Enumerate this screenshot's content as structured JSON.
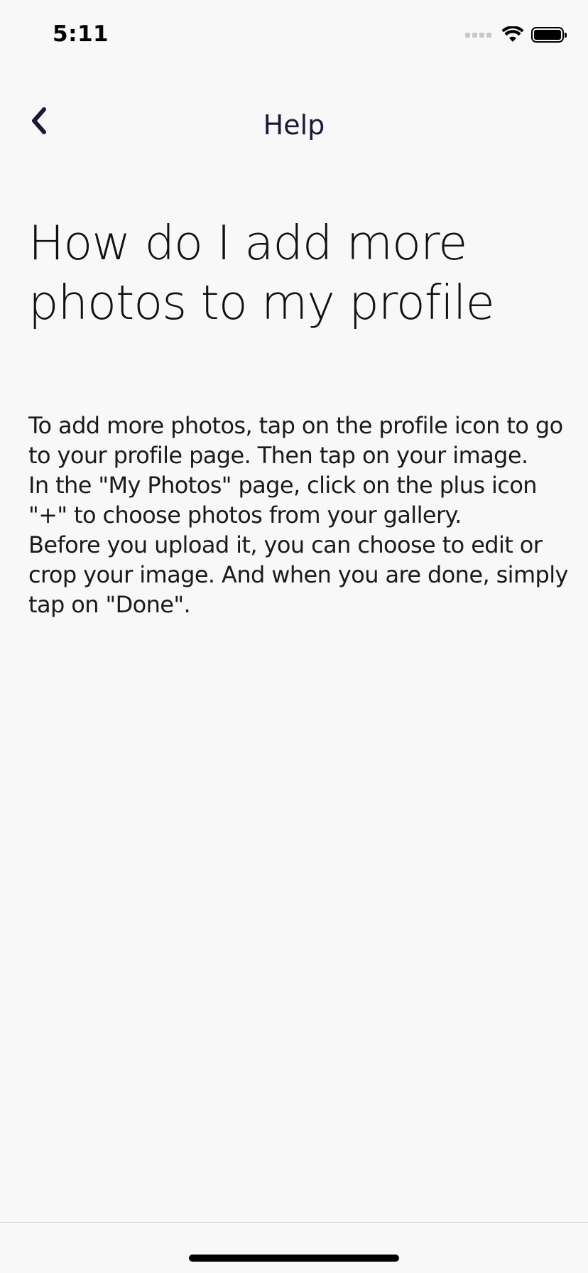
{
  "status_bar": {
    "time": "5:11",
    "icons": [
      "signal-icon",
      "wifi-icon",
      "battery-icon"
    ]
  },
  "nav": {
    "back_icon": "chevron-left-icon",
    "title": "Help"
  },
  "article": {
    "title": "How do I add more photos to my profile",
    "body": "To add more photos, tap on the profile icon to go to your profile page. Then tap on your image.\n In the \"My Photos\" page, click on the plus icon \"+\"  to choose photos from your gallery.\n Before you upload it, you can choose to edit or crop your image. And when you are done, simply tap on \"Done\"."
  },
  "colors": {
    "background": "#f8f8f8",
    "nav_tint": "#1b1838",
    "text": "#111111"
  }
}
